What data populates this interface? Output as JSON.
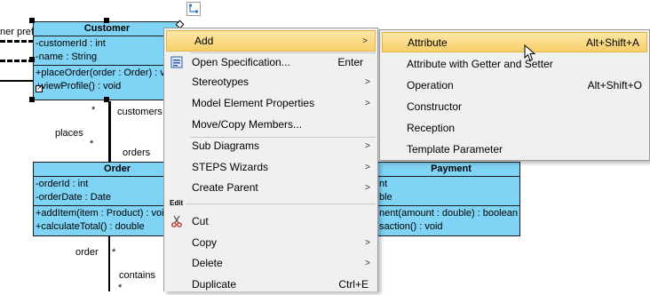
{
  "diagram": {
    "customer": {
      "name": "Customer",
      "attributes": [
        "-customerId : int",
        "-name : String"
      ],
      "operations": [
        "+placeOrder(order : Order) : v",
        "+viewProfile() : void"
      ]
    },
    "order": {
      "name": "Order",
      "attributes": [
        "-orderId : int",
        "-orderDate : Date"
      ],
      "operations": [
        "+addItem(item : Product) : voi",
        "+calculateTotal() : double"
      ]
    },
    "payment": {
      "name": "Payment",
      "attributes": [
        "nt",
        "ble"
      ],
      "operations": [
        "nent(amount : double) : boolean",
        "saction() : void"
      ]
    },
    "labels": {
      "preferences": "ner preferences",
      "customers": "customers",
      "places": "places",
      "orders": "orders",
      "order": "order",
      "contains": "contains",
      "star": "*"
    }
  },
  "context_menu": {
    "items": [
      {
        "label": "Add",
        "shortcut": "",
        "submenu": true,
        "highlighted": true,
        "icon": ""
      },
      {
        "label": "Open Specification...",
        "shortcut": "Enter",
        "submenu": false,
        "icon": "specification-icon"
      },
      {
        "label": "Stereotypes",
        "shortcut": "",
        "submenu": true,
        "icon": ""
      },
      {
        "label": "Model Element Properties",
        "shortcut": "",
        "submenu": true,
        "icon": ""
      },
      {
        "label": "Move/Copy Members...",
        "shortcut": "",
        "submenu": false,
        "icon": ""
      },
      {
        "label": "Sub Diagrams",
        "shortcut": "",
        "submenu": true,
        "icon": ""
      },
      {
        "label": "STEPS Wizards",
        "shortcut": "",
        "submenu": true,
        "icon": ""
      },
      {
        "label": "Create Parent",
        "shortcut": "",
        "submenu": true,
        "icon": ""
      },
      {
        "label": "Cut",
        "shortcut": "",
        "submenu": false,
        "icon": "scissors-icon"
      },
      {
        "label": "Copy",
        "shortcut": "",
        "submenu": true,
        "icon": ""
      },
      {
        "label": "Delete",
        "shortcut": "",
        "submenu": true,
        "icon": ""
      },
      {
        "label": "Duplicate",
        "shortcut": "Ctrl+E",
        "submenu": false,
        "icon": ""
      }
    ],
    "edit_section_label": "Edit"
  },
  "add_submenu": {
    "items": [
      {
        "label": "Attribute",
        "shortcut": "Alt+Shift+A",
        "highlighted": true
      },
      {
        "label": "Attribute with Getter and Setter",
        "shortcut": ""
      },
      {
        "label": "Operation",
        "shortcut": "Alt+Shift+O"
      },
      {
        "label": "Constructor",
        "shortcut": ""
      },
      {
        "label": "Reception",
        "shortcut": ""
      },
      {
        "label": "Template Parameter",
        "shortcut": ""
      }
    ]
  },
  "colors": {
    "class_fill": "#7fd3f5",
    "menu_bg": "#f0f0f0",
    "highlight": "#f7cf6a"
  }
}
